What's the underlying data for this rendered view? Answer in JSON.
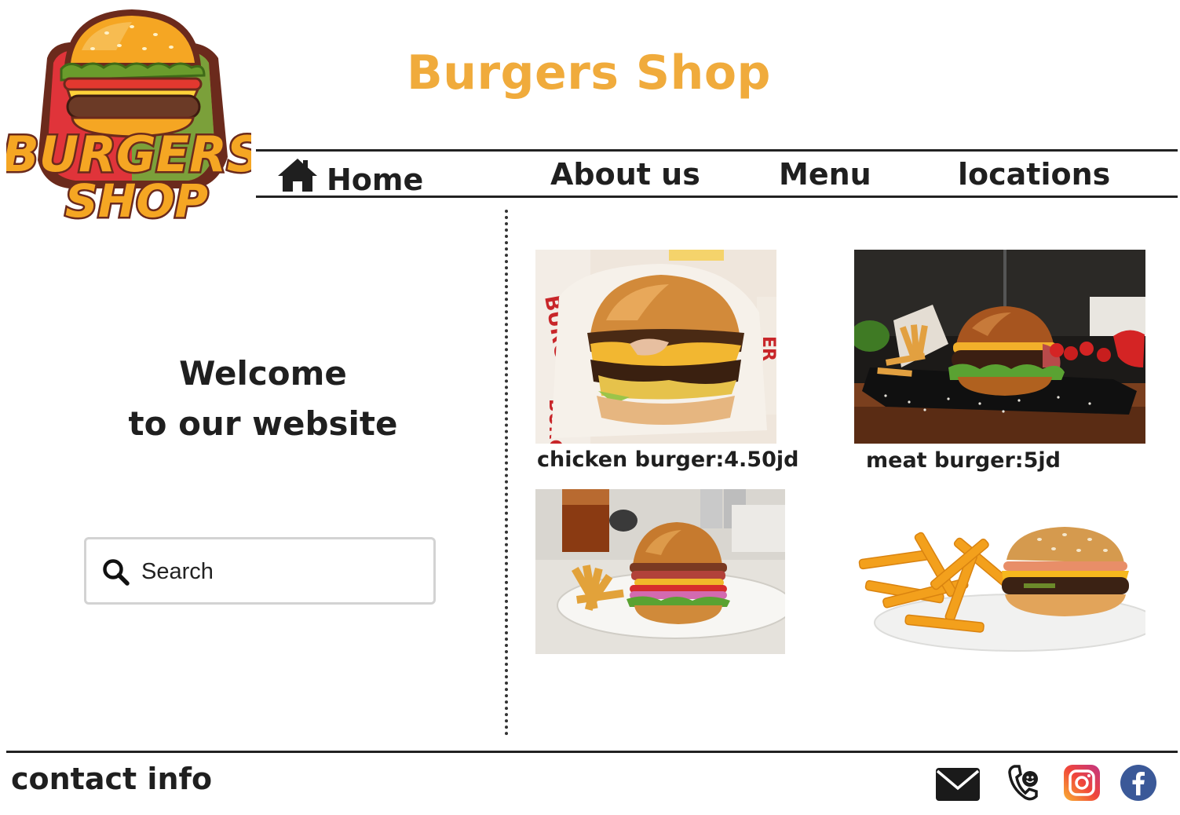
{
  "header": {
    "title": "Burgers Shop",
    "logo_text_line1": "BURGERS",
    "logo_text_line2": "SHOP"
  },
  "nav": {
    "items": [
      {
        "label": "Home",
        "icon": "home-icon"
      },
      {
        "label": "About us"
      },
      {
        "label": "Menu"
      },
      {
        "label": "locations"
      }
    ]
  },
  "hero": {
    "welcome_line1": "Welcome",
    "welcome_line2": "to our website"
  },
  "search": {
    "placeholder": "Search",
    "icon": "search-icon"
  },
  "products": [
    {
      "caption": "chicken burger:4.50jd"
    },
    {
      "caption": "meat burger:5jd"
    },
    {
      "caption": ""
    },
    {
      "caption": ""
    }
  ],
  "footer": {
    "contact_label": "contact info",
    "icons": [
      "mail-icon",
      "phone-icon",
      "instagram-icon",
      "facebook-icon"
    ]
  },
  "colors": {
    "title": "#f0ab3c",
    "text": "#1f1f1f",
    "instagram_start": "#f9b233",
    "instagram_end": "#c13584",
    "facebook": "#3b5998"
  }
}
